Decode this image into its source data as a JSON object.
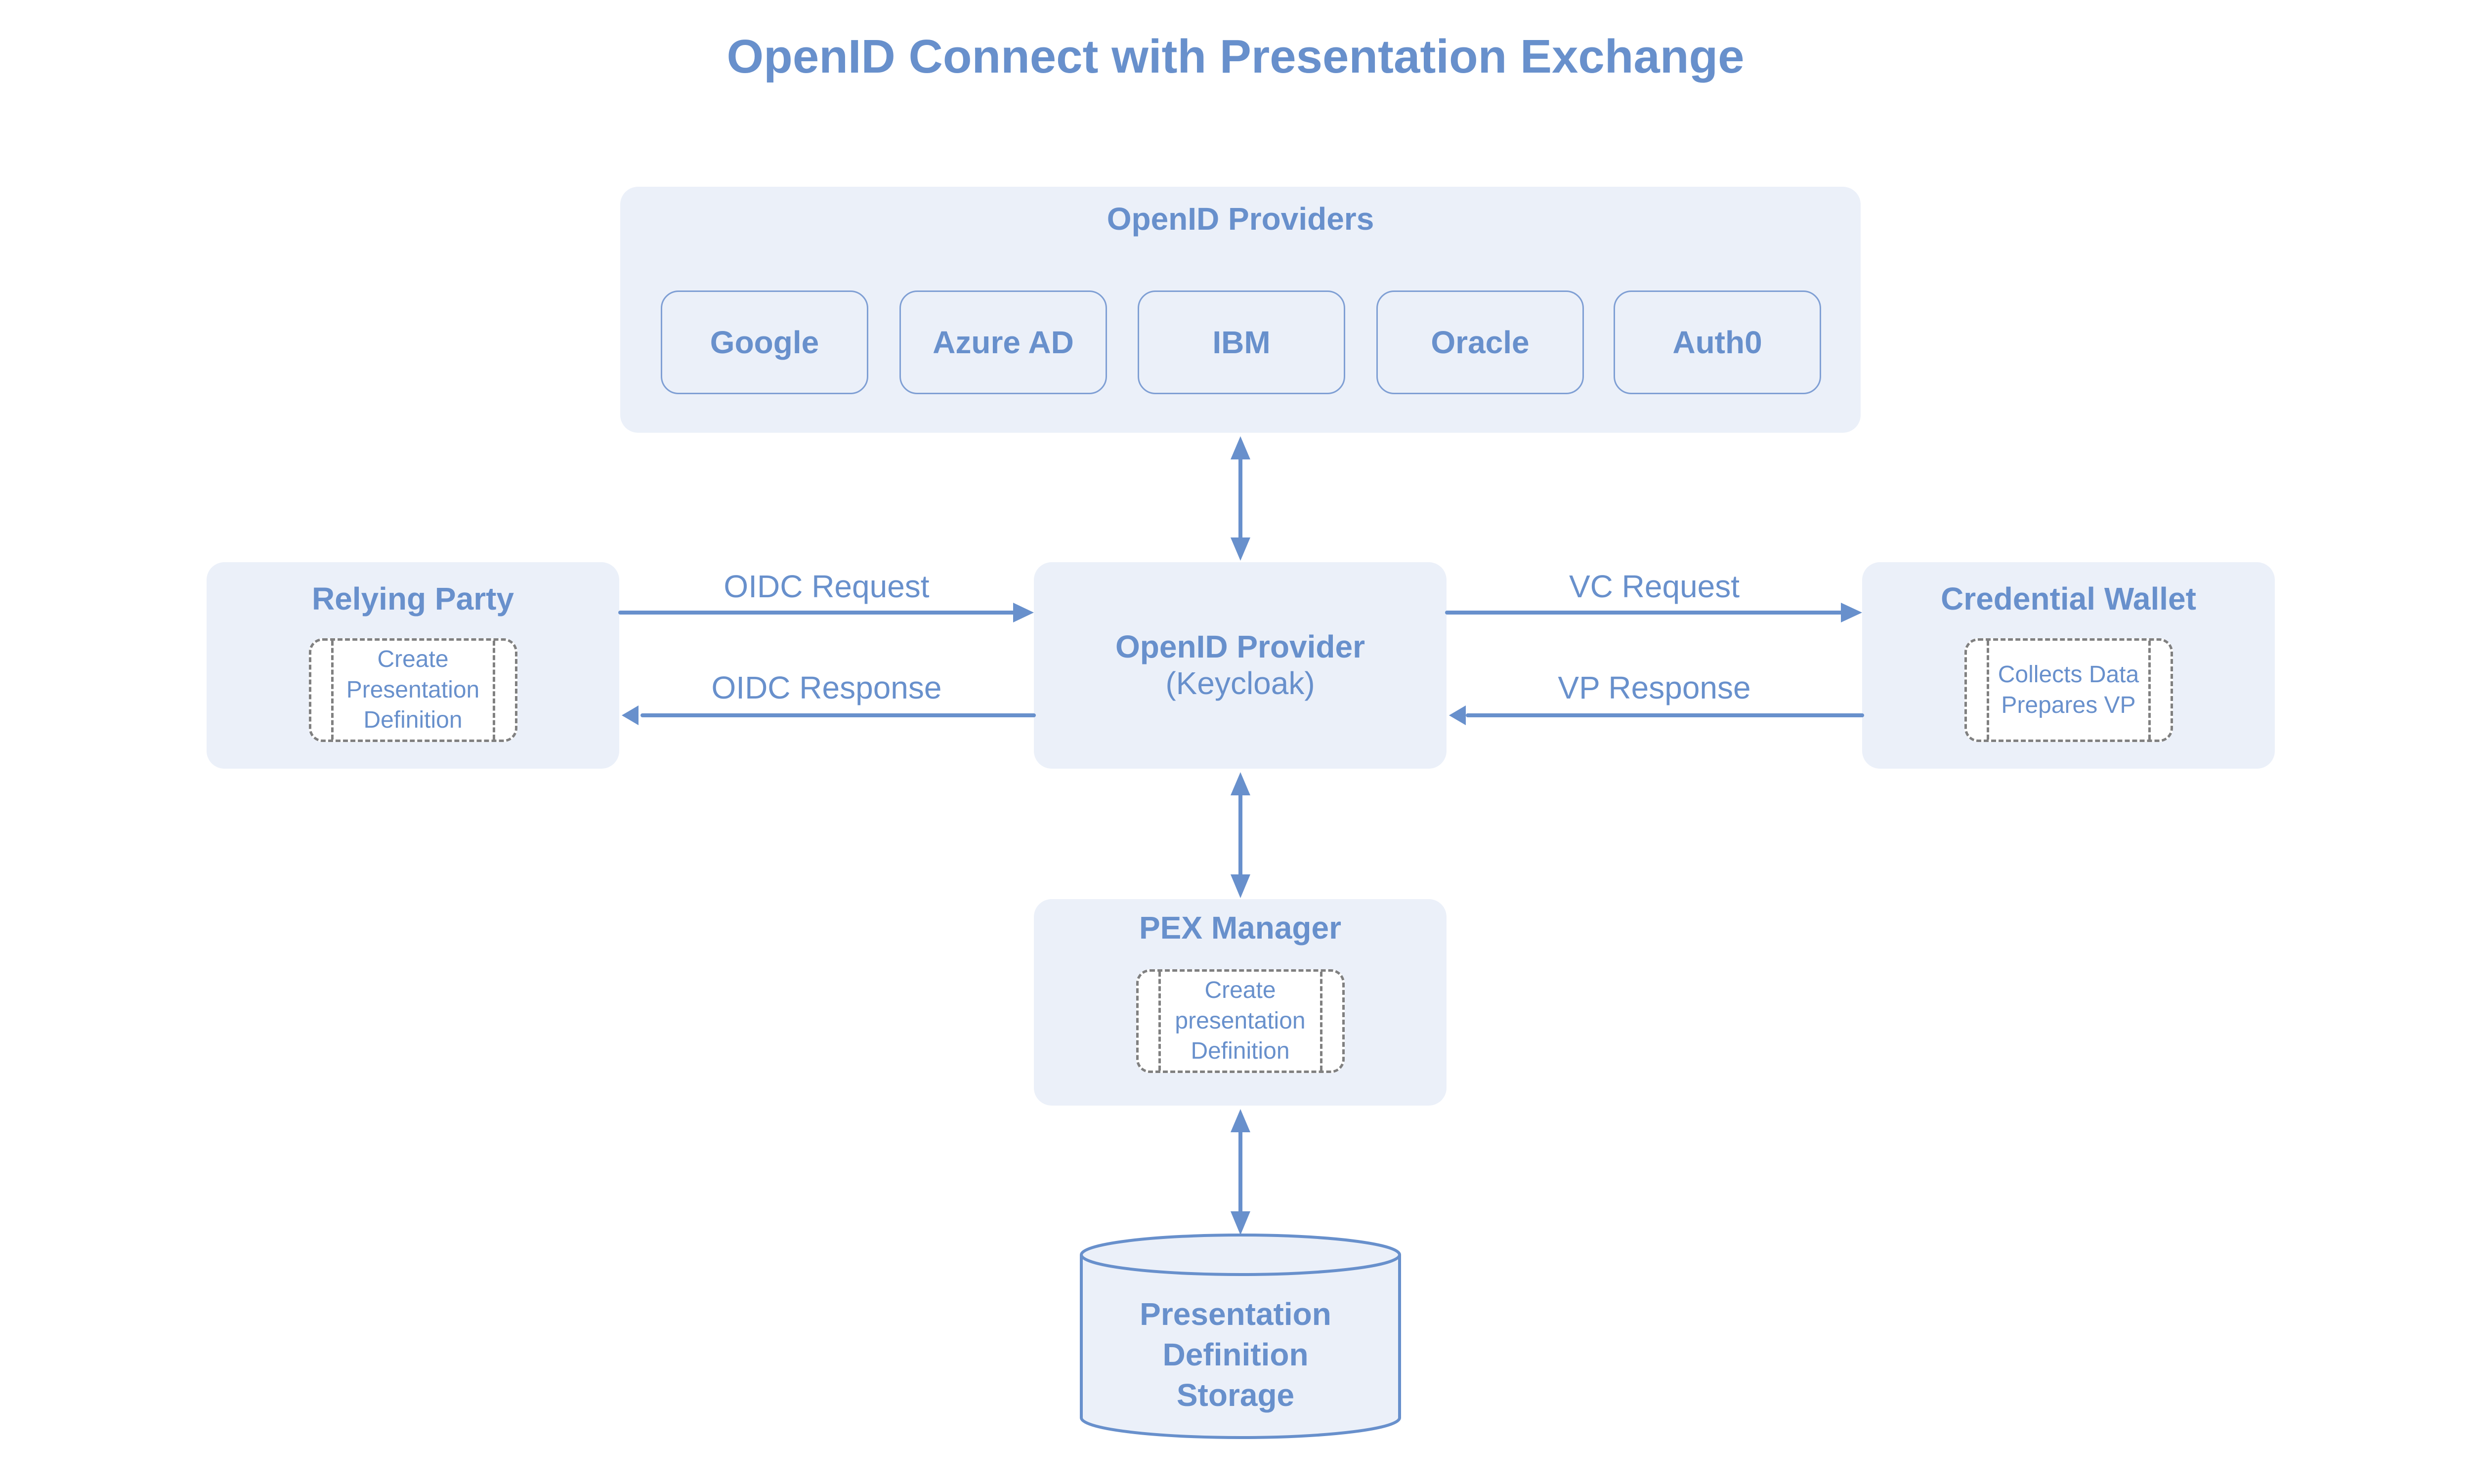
{
  "title": "OpenID Connect with Presentation Exchange",
  "colors": {
    "accent": "#6890cc",
    "panel_fill": "#ebf0f9",
    "provider_border": "#7f9fd4",
    "dashed_border": "#808080"
  },
  "providers_group": {
    "label": "OpenID Providers",
    "providers": [
      {
        "label": "Google"
      },
      {
        "label": "Azure AD"
      },
      {
        "label": "IBM"
      },
      {
        "label": "Oracle"
      },
      {
        "label": "Auth0"
      }
    ]
  },
  "nodes": {
    "relying_party": {
      "title": "Relying Party",
      "inner_lines": [
        "Create",
        "Presentation",
        "Definition"
      ]
    },
    "openid_provider": {
      "title": "OpenID Provider",
      "subtitle": "(Keycloak)"
    },
    "credential_wallet": {
      "title": "Credential Wallet",
      "inner_lines": [
        "Collects Data",
        "Prepares VP"
      ]
    },
    "pex_manager": {
      "title": "PEX Manager",
      "inner_lines": [
        "Create",
        "presentation",
        "Definition"
      ]
    },
    "storage": {
      "title_lines": [
        "Presentation",
        "Definition",
        "Storage"
      ]
    }
  },
  "edges": {
    "oidc_request": {
      "label": "OIDC Request",
      "from": "Relying Party",
      "to": "OpenID Provider"
    },
    "oidc_response": {
      "label": "OIDC Response",
      "from": "OpenID Provider",
      "to": "Relying Party"
    },
    "vc_request": {
      "label": "VC Request",
      "from": "OpenID Provider",
      "to": "Credential Wallet"
    },
    "vp_response": {
      "label": "VP Response",
      "from": "Credential Wallet",
      "to": "OpenID Provider"
    },
    "providers_link": {
      "from": "OpenID Providers",
      "to": "OpenID Provider",
      "bidirectional": true
    },
    "pex_link": {
      "from": "OpenID Provider",
      "to": "PEX Manager",
      "bidirectional": true
    },
    "storage_link": {
      "from": "PEX Manager",
      "to": "Presentation Definition Storage",
      "bidirectional": true
    }
  }
}
